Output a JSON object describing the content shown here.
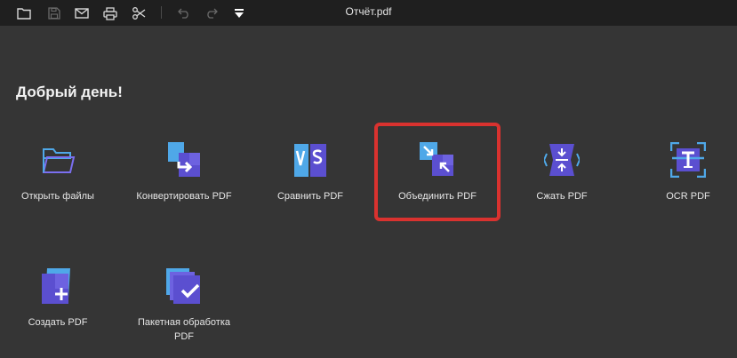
{
  "toolbar": {
    "icons": [
      "folder-open-icon",
      "save-icon",
      "mail-icon",
      "print-icon",
      "scissors-icon",
      "undo-icon",
      "redo-icon",
      "dropdown-menu-icon"
    ]
  },
  "window": {
    "title": "Отчёт.pdf"
  },
  "main": {
    "greeting": "Добрый день!",
    "tools": [
      {
        "label": "Открыть файлы",
        "icon": "folder-icon"
      },
      {
        "label": "Конвертировать PDF",
        "icon": "convert-icon"
      },
      {
        "label": "Сравнить PDF",
        "icon": "compare-icon"
      },
      {
        "label": "Объединить PDF",
        "icon": "merge-icon"
      },
      {
        "label": "Сжать PDF",
        "icon": "compress-icon"
      },
      {
        "label": "OCR PDF",
        "icon": "ocr-icon"
      },
      {
        "label": "Создать PDF",
        "icon": "create-icon"
      },
      {
        "label": "Пакетная обработка PDF",
        "icon": "batch-icon"
      }
    ],
    "highlighted_tool": "Объединить PDF"
  },
  "colors": {
    "background": "#353535",
    "titlebar": "#1f1f1f",
    "accent_purple": "#5b4fd0",
    "accent_blue": "#4fa8e8",
    "highlight_border": "#d9322f"
  }
}
